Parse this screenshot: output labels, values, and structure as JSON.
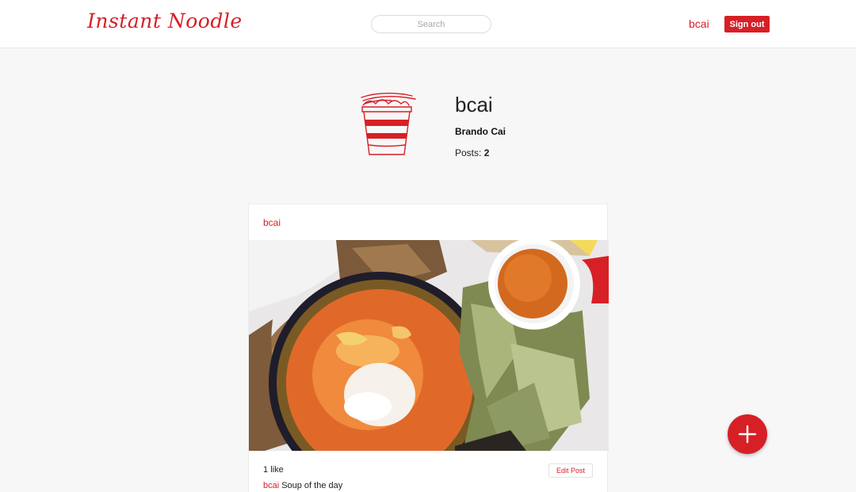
{
  "navbar": {
    "logo": "Instant Noodle",
    "search_placeholder": "Search",
    "username": "bcai",
    "signout_label": "Sign out"
  },
  "profile": {
    "username": "bcai",
    "full_name": "Brando Cai",
    "posts_label": "Posts:",
    "posts_count": "2",
    "avatar_icon": "noodle-cup-icon"
  },
  "post": {
    "username": "bcai",
    "likes_count": "1",
    "likes_label": "like",
    "edit_label": "Edit Post",
    "caption_user": "bcai",
    "caption_text": "Soup of the day"
  },
  "fab": {
    "icon": "plus-icon"
  },
  "colors": {
    "accent": "#d71f26",
    "background": "#f7f7f7",
    "card": "#ffffff"
  }
}
